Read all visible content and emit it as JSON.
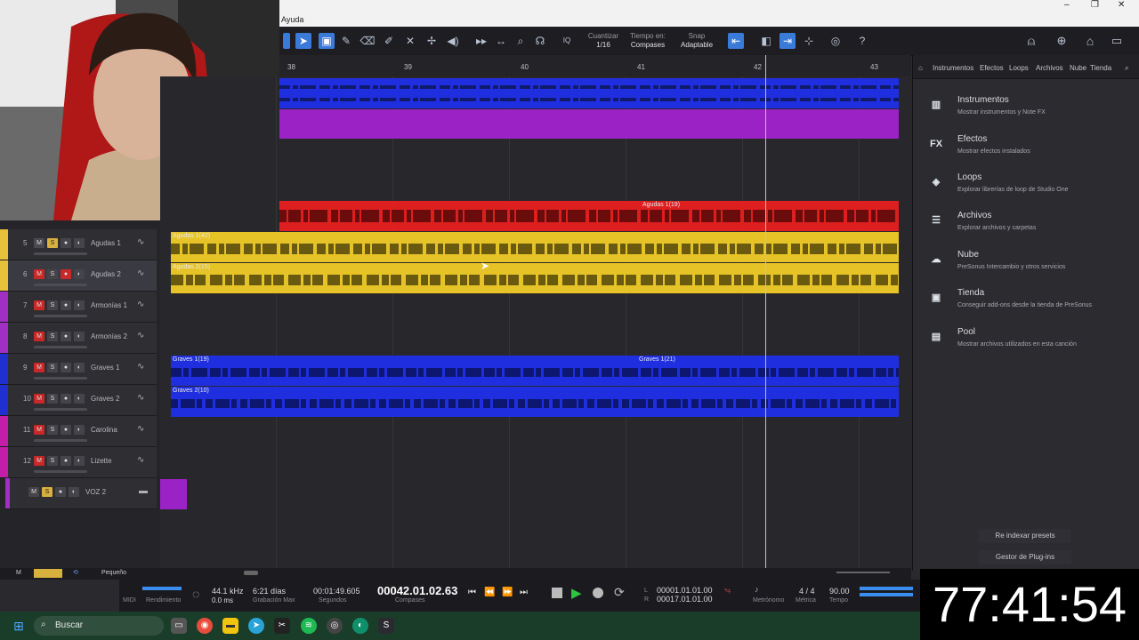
{
  "window": {
    "menu_help": "Ayuda",
    "minimize": "–",
    "restore": "❐",
    "close": "✕"
  },
  "toolbar": {
    "quantize_label": "Cuantizar",
    "quantize_value": "1/16",
    "timebase_label": "Tiempo en:",
    "timebase_value": "Compases",
    "snap_label": "Snap",
    "snap_value": "Adaptable",
    "iq_label": "IQ",
    "help": "?"
  },
  "ruler": {
    "bars": [
      "38",
      "39",
      "40",
      "41",
      "42",
      "43"
    ]
  },
  "tracks": [
    {
      "num": "5",
      "name": "Agudas 1",
      "color": "#e6c23a"
    },
    {
      "num": "6",
      "name": "Agudas 2",
      "color": "#e6c23a"
    },
    {
      "num": "7",
      "name": "Armonías 1",
      "color": "#a22fc4"
    },
    {
      "num": "8",
      "name": "Armonías 2",
      "color": "#a22fc4"
    },
    {
      "num": "9",
      "name": "Graves 1",
      "color": "#1f2fd0"
    },
    {
      "num": "10",
      "name": "Graves 2",
      "color": "#1f2fd0"
    },
    {
      "num": "11",
      "name": "Carolina",
      "color": "#c21ea8"
    },
    {
      "num": "12",
      "name": "Lizette",
      "color": "#c21ea8"
    },
    {
      "num": "",
      "name": "VOZ 2",
      "color": "#a22fc4"
    }
  ],
  "track_buttons": {
    "mute": "M",
    "solo": "S"
  },
  "clips": {
    "red_1": "Agudas 1(19)",
    "yellow_1": "Agudas 1(42)",
    "yellow_2": "Agudas 2(15)",
    "blue_1a": "Graves 1(19)",
    "blue_1b": "Graves 1(21)",
    "blue_2": "Graves 2(10)"
  },
  "arrange_footer": {
    "m": "M",
    "size": "Pequeño"
  },
  "transport": {
    "midi_label": "MIDI",
    "perf_label": "Rendimiento",
    "sample_rate": "44.1 kHz",
    "latency": "0.0 ms",
    "rec_time": "6:21 días",
    "rec_max_label": "Grabación Max",
    "seconds_value": "00:01:49.605",
    "seconds_label": "Segundos",
    "position": "00042.01.02.63",
    "position_label": "Compases",
    "loop_l_label": "L",
    "loop_l": "00001.01.01.00",
    "loop_r_label": "R",
    "loop_r": "00017.01.01.00",
    "metronome_label": "Metrónomo",
    "meter_value": "4 / 4",
    "meter_label": "Métrica",
    "tempo_value": "90.00",
    "tempo_label": "Tempo"
  },
  "browser": {
    "tabs": [
      "Instrumentos",
      "Efectos",
      "Loops",
      "Archivos",
      "Nube",
      "Tienda"
    ],
    "items": [
      {
        "title": "Instrumentos",
        "sub": "Mostrar instrumentos y Note FX",
        "icon": "piano-icon",
        "glyph": "▥"
      },
      {
        "title": "Efectos",
        "sub": "Mostrar efectos instalados",
        "icon": "fx-icon",
        "glyph": "FX"
      },
      {
        "title": "Loops",
        "sub": "Explorar librerías de loop de Studio One",
        "icon": "loops-icon",
        "glyph": "◈"
      },
      {
        "title": "Archivos",
        "sub": "Explorar archivos y carpetas",
        "icon": "files-icon",
        "glyph": "☰"
      },
      {
        "title": "Nube",
        "sub": "PreSonus Intercambio y otros servicios",
        "icon": "cloud-icon",
        "glyph": "☁"
      },
      {
        "title": "Tienda",
        "sub": "Conseguir add-ons desde la tienda de PreSonus",
        "icon": "store-icon",
        "glyph": "▣"
      },
      {
        "title": "Pool",
        "sub": "Mostrar archivos utilizados en esta canción",
        "icon": "pool-icon",
        "glyph": "▤"
      }
    ],
    "reindex": "Re indexar presets",
    "plugin_manager": "Gestor de Plug-ins"
  },
  "clock": "77:41:54",
  "taskbar": {
    "search": "Buscar"
  }
}
